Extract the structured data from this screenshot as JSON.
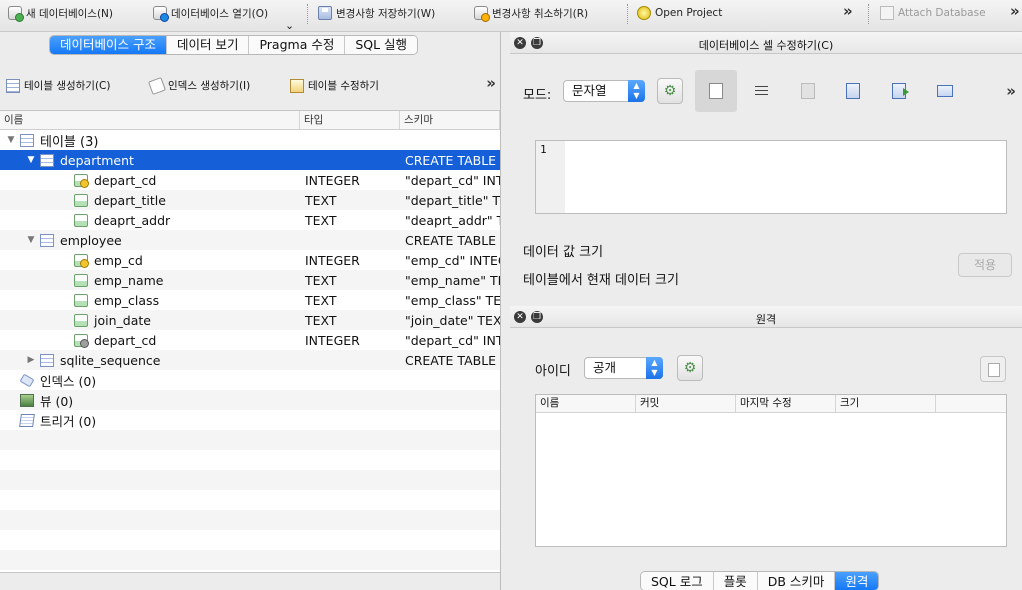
{
  "toolbar": {
    "new_db": "새 데이터베이스(N)",
    "open_db": "데이터베이스 열기(O)",
    "write_changes": "변경사항 저장하기(W)",
    "revert_changes": "변경사항 취소하기(R)",
    "open_project": "Open Project",
    "attach_db": "Attach Database",
    "more": "»",
    "dropdown": "⌄"
  },
  "main_tabs": [
    {
      "label": "데이터베이스 구조",
      "active": true
    },
    {
      "label": "데이터 보기",
      "active": false
    },
    {
      "label": "Pragma 수정",
      "active": false
    },
    {
      "label": "SQL 실행",
      "active": false
    }
  ],
  "structure_toolbar": {
    "create_table": "테이블 생성하기(C)",
    "create_index": "인덱스 생성하기(I)",
    "modify_table": "테이블 수정하기",
    "more": "»"
  },
  "tree": {
    "columns": [
      "이름",
      "타입",
      "스키마"
    ],
    "rows": [
      {
        "level": 0,
        "disclosure": "▼",
        "icon": "table-icon",
        "name": "테이블 (3)",
        "type": "",
        "schema": "",
        "selected": false,
        "bold": true
      },
      {
        "level": 1,
        "disclosure": "▼",
        "icon": "table-icon",
        "name": "department",
        "type": "",
        "schema": "CREATE TABLE",
        "selected": true
      },
      {
        "level": 2,
        "disclosure": "",
        "icon": "key-field-icon",
        "name": "depart_cd",
        "type": "INTEGER",
        "schema": "\"depart_cd\" INTEGER",
        "selected": false
      },
      {
        "level": 2,
        "disclosure": "",
        "icon": "field-icon",
        "name": "depart_title",
        "type": "TEXT",
        "schema": "\"depart_title\" TEXT",
        "selected": false
      },
      {
        "level": 2,
        "disclosure": "",
        "icon": "field-icon",
        "name": "deaprt_addr",
        "type": "TEXT",
        "schema": "\"deaprt_addr\" TEXT",
        "selected": false
      },
      {
        "level": 1,
        "disclosure": "▼",
        "icon": "table-icon",
        "name": "employee",
        "type": "",
        "schema": "CREATE TABLE",
        "selected": false
      },
      {
        "level": 2,
        "disclosure": "",
        "icon": "key-field-icon",
        "name": "emp_cd",
        "type": "INTEGER",
        "schema": "\"emp_cd\" INTEGER",
        "selected": false
      },
      {
        "level": 2,
        "disclosure": "",
        "icon": "field-icon",
        "name": "emp_name",
        "type": "TEXT",
        "schema": "\"emp_name\" TEXT",
        "selected": false
      },
      {
        "level": 2,
        "disclosure": "",
        "icon": "field-icon",
        "name": "emp_class",
        "type": "TEXT",
        "schema": "\"emp_class\" TEXT",
        "selected": false
      },
      {
        "level": 2,
        "disclosure": "",
        "icon": "field-icon",
        "name": "join_date",
        "type": "TEXT",
        "schema": "\"join_date\" TEXT",
        "selected": false
      },
      {
        "level": 2,
        "disclosure": "",
        "icon": "foreign-key-field-icon",
        "name": "depart_cd",
        "type": "INTEGER",
        "schema": "\"depart_cd\" INTEGER",
        "selected": false
      },
      {
        "level": 1,
        "disclosure": "▶",
        "icon": "table-icon",
        "name": "sqlite_sequence",
        "type": "",
        "schema": "CREATE TABLE",
        "selected": false
      },
      {
        "level": 0,
        "disclosure": "",
        "icon": "index-icon",
        "name": "인덱스 (0)",
        "type": "",
        "schema": "",
        "selected": false
      },
      {
        "level": 0,
        "disclosure": "",
        "icon": "view-icon",
        "name": "뷰 (0)",
        "type": "",
        "schema": "",
        "selected": false
      },
      {
        "level": 0,
        "disclosure": "",
        "icon": "trigger-icon",
        "name": "트리거 (0)",
        "type": "",
        "schema": "",
        "selected": false
      },
      {
        "level": 0,
        "disclosure": "",
        "icon": "",
        "name": "",
        "type": "",
        "schema": "",
        "selected": false
      },
      {
        "level": 0,
        "disclosure": "",
        "icon": "",
        "name": "",
        "type": "",
        "schema": "",
        "selected": false
      },
      {
        "level": 0,
        "disclosure": "",
        "icon": "",
        "name": "",
        "type": "",
        "schema": "",
        "selected": false
      },
      {
        "level": 0,
        "disclosure": "",
        "icon": "",
        "name": "",
        "type": "",
        "schema": "",
        "selected": false
      },
      {
        "level": 0,
        "disclosure": "",
        "icon": "",
        "name": "",
        "type": "",
        "schema": "",
        "selected": false
      },
      {
        "level": 0,
        "disclosure": "",
        "icon": "",
        "name": "",
        "type": "",
        "schema": "",
        "selected": false
      },
      {
        "level": 0,
        "disclosure": "",
        "icon": "",
        "name": "",
        "type": "",
        "schema": "",
        "selected": false
      },
      {
        "level": 0,
        "disclosure": "",
        "icon": "",
        "name": "",
        "type": "",
        "schema": "",
        "selected": false
      }
    ]
  },
  "edit_cell": {
    "title": "데이터베이스 셀 수정하기(C)",
    "mode_label": "모드:",
    "mode_value": "문자열",
    "line_number": "1",
    "data_size_label": "데이터 값 크기",
    "table_size_label": "테이블에서 현재 데이터 크기",
    "apply": "적용",
    "more": "»"
  },
  "remote": {
    "title": "원격",
    "id_label": "아이디",
    "id_value": "공개",
    "columns": [
      "이름",
      "커밋",
      "마지막 수정",
      "크기"
    ]
  },
  "bottom_tabs": [
    {
      "label": "SQL 로그",
      "active": false
    },
    {
      "label": "플롯",
      "active": false
    },
    {
      "label": "DB 스키마",
      "active": false
    },
    {
      "label": "원격",
      "active": true
    }
  ],
  "colors": {
    "accent": "#1478f5",
    "selection": "#1560d8"
  }
}
